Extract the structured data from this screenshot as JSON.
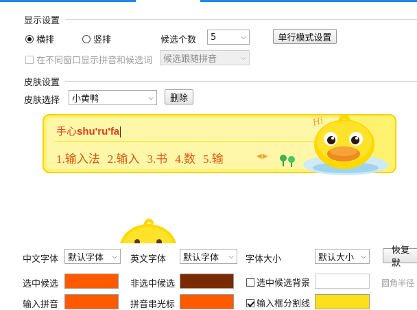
{
  "display_settings": {
    "title": "显示设置",
    "layout_horizontal": "横排",
    "layout_vertical": "竖排",
    "candidate_count_label": "候选个数",
    "candidate_count_value": "5",
    "single_line_button": "单行模式设置",
    "separate_window_label": "在不同窗口显示拼音和候选词",
    "follow_select_value": "候选跟随拼音"
  },
  "skin_settings": {
    "title": "皮肤设置",
    "skin_select_label": "皮肤选择",
    "skin_value": "小黄鸭",
    "delete_button": "删除"
  },
  "preview": {
    "pinyin_prefix": "手心",
    "pinyin_typed": "shu'ru'fa",
    "candidates": [
      "1.输入法",
      "2.输入",
      "3.书",
      "4.数",
      "5.输"
    ],
    "hi_text": "Hi"
  },
  "font_settings": {
    "chinese_font_label": "中文字体",
    "chinese_font_value": "默认字体",
    "english_font_label": "英文字体",
    "english_font_value": "默认字体",
    "font_size_label": "字体大小",
    "font_size_value": "默认大小",
    "restore_button": "恢复默",
    "selected_candidate_label": "选中候选",
    "unselected_candidate_label": "非选中候选",
    "selected_bg_label": "选中候选背景",
    "corner_radius_label": "圆角半径",
    "input_pinyin_label": "输入拼音",
    "pinyin_cursor_label": "拼音串光标",
    "divider_label": "输入框分割线"
  },
  "colors": {
    "selected_candidate": "#ff5a00",
    "unselected_candidate": "#7a2a00",
    "input_pinyin": "#ff5a00",
    "pinyin_cursor": "#ff5a00",
    "divider": "#ffde1a",
    "accent": "#1e88e5"
  }
}
